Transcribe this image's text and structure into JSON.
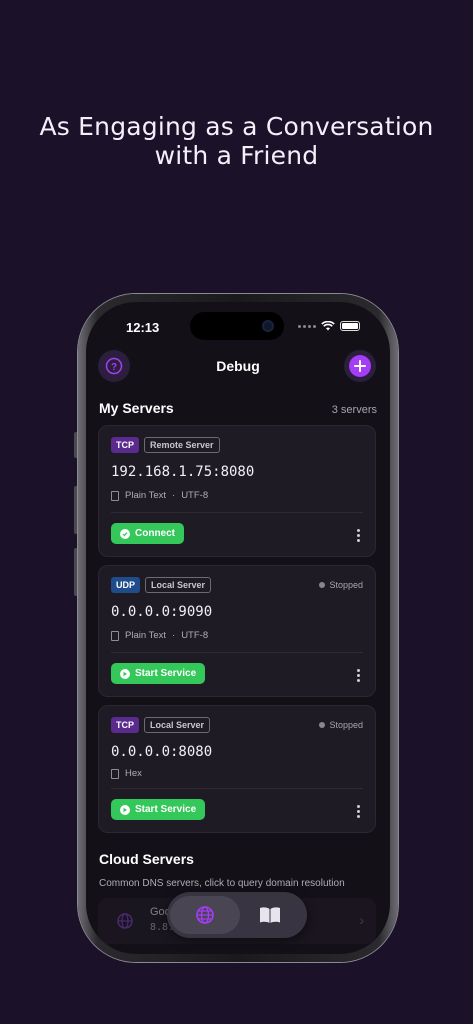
{
  "headline": {
    "line1": "As Engaging as a Conversation",
    "line2": "with a Friend"
  },
  "status_bar": {
    "time": "12:13"
  },
  "nav": {
    "title": "Debug",
    "help_icon": "question-circle-icon",
    "add_icon": "plus-icon"
  },
  "my_servers": {
    "title": "My Servers",
    "count": "3 servers",
    "items": [
      {
        "protocol": "TCP",
        "protocol_color": "#5b2a8e",
        "type": "Remote Server",
        "status": "",
        "address": "192.168.1.75:8080",
        "format": "Plain Text",
        "encoding": "UTF-8",
        "action": "Connect",
        "action_icon": "check-circle-icon"
      },
      {
        "protocol": "UDP",
        "protocol_color": "#1f4d8c",
        "type": "Local Server",
        "status": "Stopped",
        "address": "0.0.0.0:9090",
        "format": "Plain Text",
        "encoding": "UTF-8",
        "action": "Start Service",
        "action_icon": "play-icon"
      },
      {
        "protocol": "TCP",
        "protocol_color": "#5b2a8e",
        "type": "Local Server",
        "status": "Stopped",
        "address": "0.0.0.0:8080",
        "format": "Hex",
        "encoding": "",
        "action": "Start Service",
        "action_icon": "play-icon"
      }
    ]
  },
  "cloud_servers": {
    "title": "Cloud Servers",
    "subtitle": "Common DNS servers, click to query domain resolution",
    "items": [
      {
        "name": "Goo",
        "ip": "8.8."
      }
    ]
  },
  "tabbar": {
    "tabs": [
      {
        "icon": "globe-icon",
        "active": true
      },
      {
        "icon": "book-icon",
        "active": false
      }
    ]
  },
  "colors": {
    "accent": "#a43df5",
    "success": "#34c759",
    "background": "#1b1128"
  }
}
